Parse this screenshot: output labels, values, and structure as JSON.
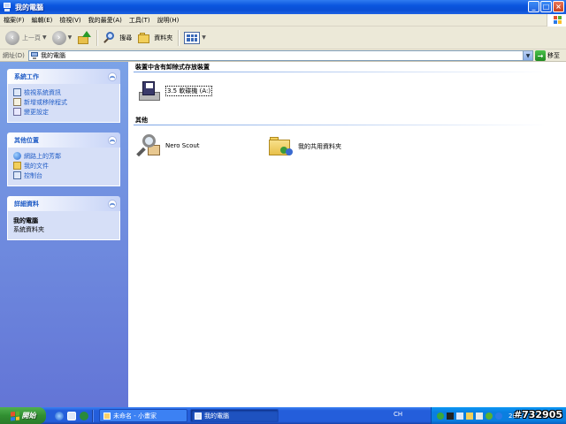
{
  "window": {
    "title": "我的電腦",
    "controls": {
      "minimize": "_",
      "maximize": "□",
      "close": "×"
    }
  },
  "menubar": {
    "items": [
      "檔案(F)",
      "編輯(E)",
      "檢視(V)",
      "我的最愛(A)",
      "工具(T)",
      "說明(H)"
    ]
  },
  "toolbar": {
    "back_label": "上一頁",
    "search_label": "搜尋",
    "folders_label": "資料夾"
  },
  "address": {
    "label": "網址(D)",
    "value": "我的電腦",
    "go_label": "移至"
  },
  "left_pane": {
    "system_tasks": {
      "title": "系統工作",
      "items": [
        "檢視系統資訊",
        "新增或移除程式",
        "變更設定"
      ]
    },
    "other_places": {
      "title": "其他位置",
      "items": [
        "網路上的芳鄰",
        "我的文件",
        "控制台"
      ]
    },
    "details": {
      "title": "詳細資料",
      "name": "我的電腦",
      "type": "系統資料夾"
    }
  },
  "main": {
    "removable": {
      "heading": "裝置中含有卸除式存放裝置",
      "items": [
        {
          "label": "3.5 軟碟機 (A:)",
          "icon": "floppy-drive-icon"
        }
      ]
    },
    "other": {
      "heading": "其他",
      "items": [
        {
          "label": "Nero Scout",
          "icon": "nero-scout-icon"
        },
        {
          "label": "我的共用資料夾",
          "icon": "shared-folder-icon"
        }
      ]
    }
  },
  "taskbar": {
    "start_label": "開始",
    "buttons": [
      {
        "label": "未命名 - 小畫家",
        "active": false
      },
      {
        "label": "我的電腦",
        "active": true
      }
    ],
    "language": "CH",
    "clock": "20:51",
    "watermark": "#732905"
  },
  "colors": {
    "title_bar": "#0a55de",
    "left_pane_top": "#7ba2e7",
    "left_pane_bottom": "#6375d6",
    "panel_header_text": "#215dc6",
    "taskbar": "#245edb",
    "start_button": "#318f31"
  }
}
